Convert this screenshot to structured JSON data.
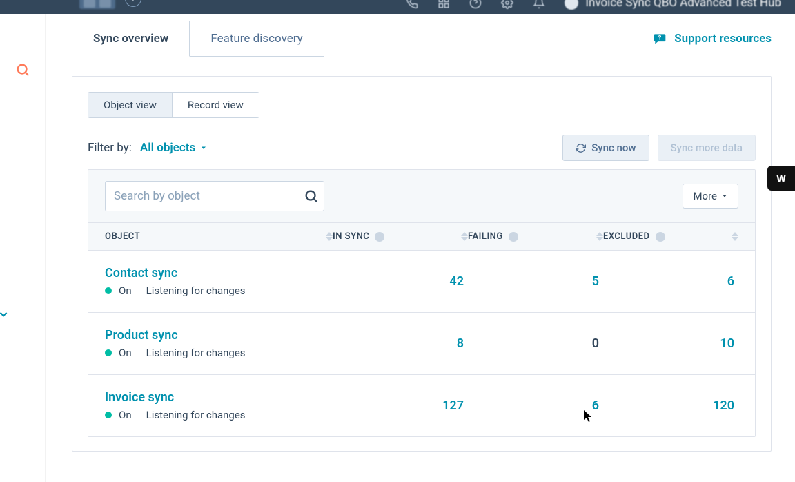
{
  "header": {
    "account_title": "Invoice Sync QBO Advanced Test Hub"
  },
  "tabs": {
    "overview": "Sync overview",
    "feature": "Feature discovery"
  },
  "support": {
    "label": "Support resources"
  },
  "views": {
    "object": "Object view",
    "record": "Record view"
  },
  "filter": {
    "label": "Filter by:",
    "value": "All objects"
  },
  "actions": {
    "sync_now": "Sync now",
    "sync_more": "Sync more data",
    "more": "More"
  },
  "search": {
    "placeholder": "Search by object"
  },
  "columns": {
    "object": "OBJECT",
    "in_sync": "IN SYNC",
    "failing": "FAILING",
    "excluded": "EXCLUDED"
  },
  "row_status": {
    "on": "On",
    "listening": "Listening for changes"
  },
  "rows": [
    {
      "name": "Contact sync",
      "in_sync": "42",
      "in_sync_link": true,
      "failing": "5",
      "failing_link": true,
      "excluded": "6",
      "excluded_link": true
    },
    {
      "name": "Product sync",
      "in_sync": "8",
      "in_sync_link": true,
      "failing": "0",
      "failing_link": false,
      "excluded": "10",
      "excluded_link": true
    },
    {
      "name": "Invoice sync",
      "in_sync": "127",
      "in_sync_link": true,
      "failing": "6",
      "failing_link": true,
      "excluded": "120",
      "excluded_link": true
    }
  ],
  "widget": {
    "label": "W"
  }
}
